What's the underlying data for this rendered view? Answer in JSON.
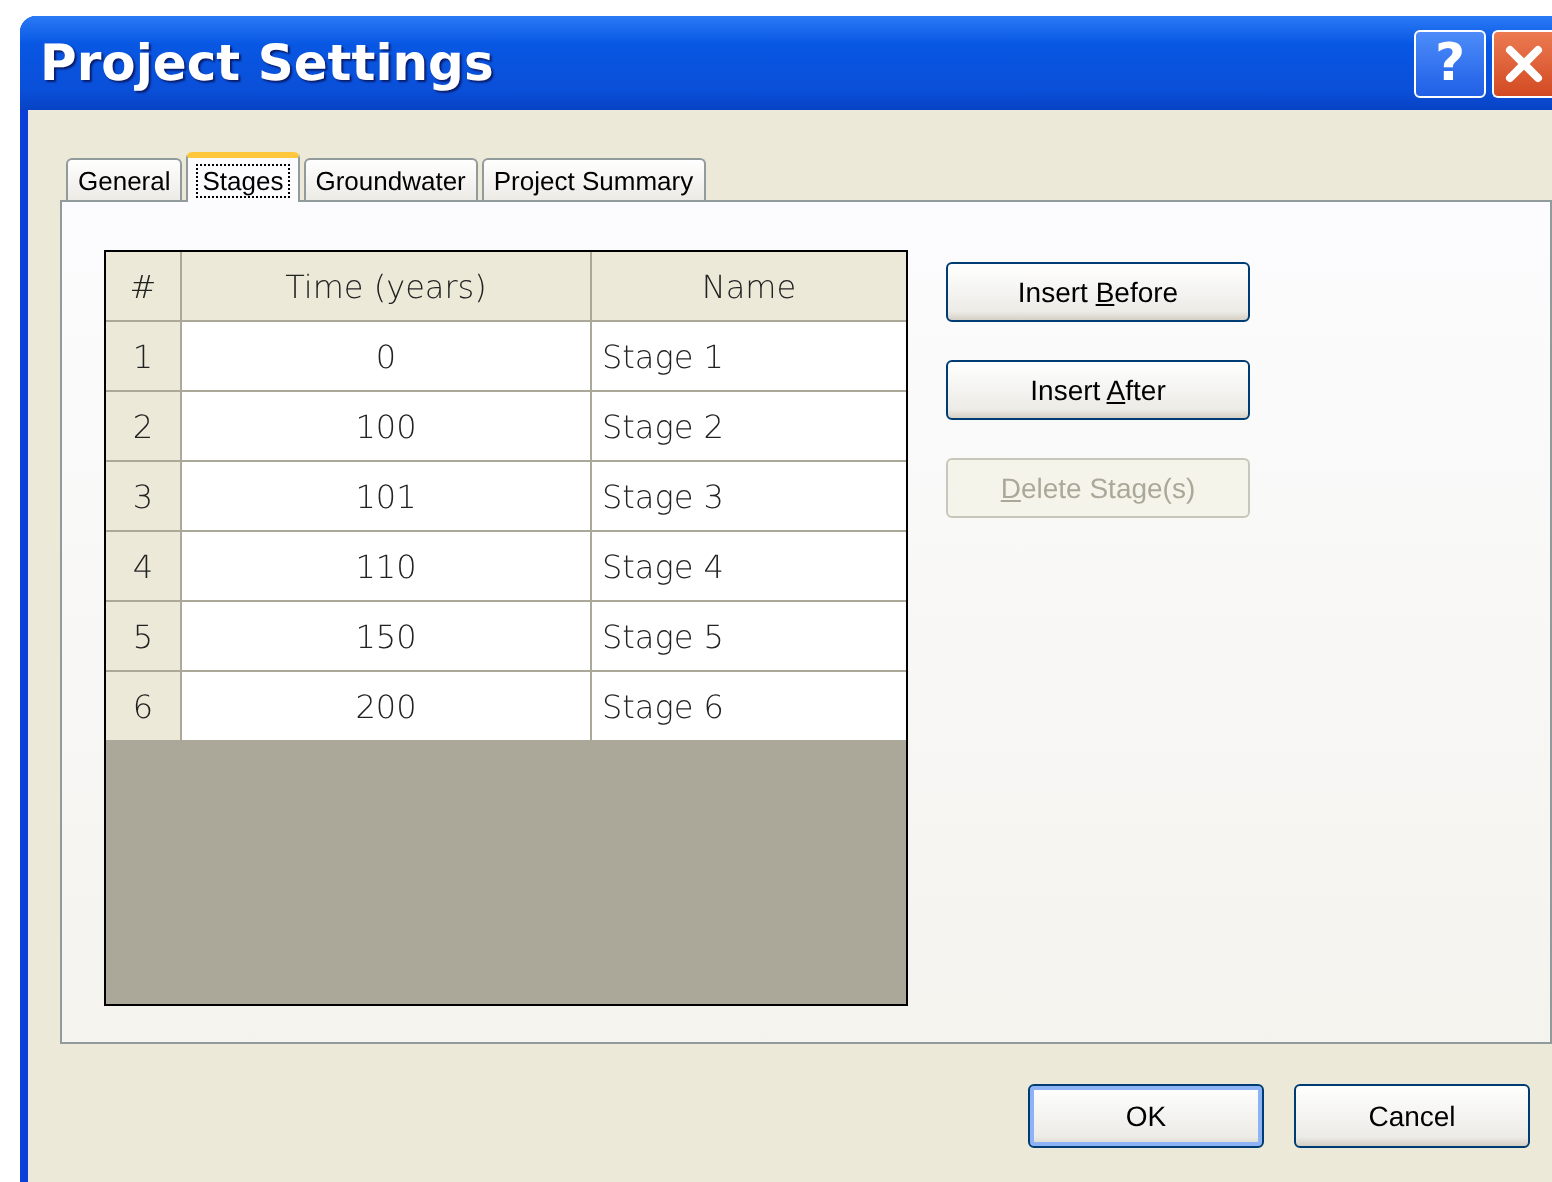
{
  "window": {
    "title": "Project Settings",
    "help_button": "?"
  },
  "tabs": [
    {
      "label": "General",
      "selected": false
    },
    {
      "label": "Stages",
      "selected": true
    },
    {
      "label": "Groundwater",
      "selected": false
    },
    {
      "label": "Project Summary",
      "selected": false
    }
  ],
  "table": {
    "columns": [
      "#",
      "Time (years)",
      "Name"
    ],
    "rows": [
      [
        "1",
        "0",
        "Stage 1"
      ],
      [
        "2",
        "100",
        "Stage 2"
      ],
      [
        "3",
        "101",
        "Stage 3"
      ],
      [
        "4",
        "110",
        "Stage 4"
      ],
      [
        "5",
        "150",
        "Stage 5"
      ],
      [
        "6",
        "200",
        "Stage 6"
      ]
    ]
  },
  "side_buttons": [
    {
      "label_pre": "Insert ",
      "access_key": "B",
      "label_post": "efore",
      "disabled": false
    },
    {
      "label_pre": "Insert ",
      "access_key": "A",
      "label_post": "fter",
      "disabled": false
    },
    {
      "access_key": "D",
      "label_post": "elete Stage(s)",
      "disabled": true
    }
  ],
  "buttons": [
    {
      "label": "OK",
      "default": true
    },
    {
      "label": "Cancel",
      "default": false
    }
  ]
}
